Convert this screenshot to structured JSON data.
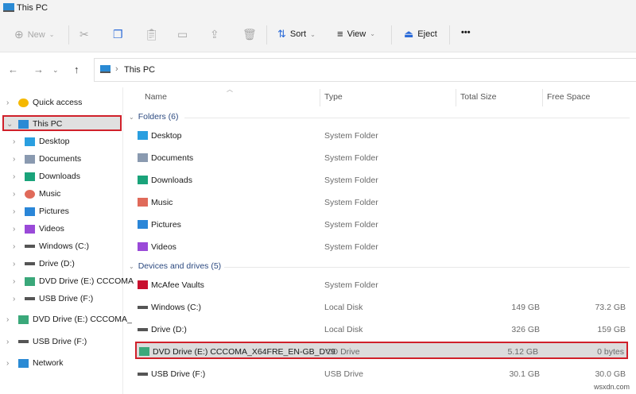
{
  "window": {
    "title": "This PC"
  },
  "toolbar": {
    "new": "New",
    "sort": "Sort",
    "view": "View",
    "eject": "Eject",
    "more": "•••"
  },
  "address": {
    "path": "This PC"
  },
  "sidebar": {
    "items": [
      {
        "label": "Quick access",
        "icon": "star-icon",
        "color": "#f5b800"
      },
      {
        "label": "This PC",
        "icon": "computer-icon",
        "color": "#2a8ad4"
      },
      {
        "label": "Desktop",
        "icon": "desktop-icon",
        "color": "#2a9fe0"
      },
      {
        "label": "Documents",
        "icon": "documents-icon",
        "color": "#8a9ab0"
      },
      {
        "label": "Downloads",
        "icon": "downloads-icon",
        "color": "#1aa37a"
      },
      {
        "label": "Music",
        "icon": "music-icon",
        "color": "#e06a5a"
      },
      {
        "label": "Pictures",
        "icon": "pictures-icon",
        "color": "#2a86d8"
      },
      {
        "label": "Videos",
        "icon": "videos-icon",
        "color": "#9a4ad8"
      },
      {
        "label": "Windows (C:)",
        "icon": "drive-icon",
        "color": "#555"
      },
      {
        "label": "Drive (D:)",
        "icon": "drive-icon",
        "color": "#555"
      },
      {
        "label": "DVD Drive (E:) CCCOMA",
        "icon": "dvd-icon",
        "color": "#3aa87a"
      },
      {
        "label": "USB Drive (F:)",
        "icon": "drive-icon",
        "color": "#555"
      },
      {
        "label": "DVD Drive (E:) CCCOMA_",
        "icon": "dvd-icon",
        "color": "#3aa87a"
      },
      {
        "label": "USB Drive (F:)",
        "icon": "drive-icon",
        "color": "#555"
      },
      {
        "label": "Network",
        "icon": "network-icon",
        "color": "#2a8ad4"
      }
    ]
  },
  "columns": {
    "name": "Name",
    "type": "Type",
    "total": "Total Size",
    "free": "Free Space"
  },
  "groups": {
    "folders": "Folders (6)",
    "devices": "Devices and drives (5)"
  },
  "folders": [
    {
      "name": "Desktop",
      "type": "System Folder",
      "color": "#2a9fe0"
    },
    {
      "name": "Documents",
      "type": "System Folder",
      "color": "#8a9ab0"
    },
    {
      "name": "Downloads",
      "type": "System Folder",
      "color": "#1aa37a"
    },
    {
      "name": "Music",
      "type": "System Folder",
      "color": "#e06a5a"
    },
    {
      "name": "Pictures",
      "type": "System Folder",
      "color": "#2a86d8"
    },
    {
      "name": "Videos",
      "type": "System Folder",
      "color": "#9a4ad8"
    }
  ],
  "drives": [
    {
      "name": "McAfee Vaults",
      "type": "System Folder",
      "total": "",
      "free": "",
      "color": "#c8102e"
    },
    {
      "name": "Windows (C:)",
      "type": "Local Disk",
      "total": "149 GB",
      "free": "73.2 GB",
      "color": "#555"
    },
    {
      "name": "Drive (D:)",
      "type": "Local Disk",
      "total": "326 GB",
      "free": "159 GB",
      "color": "#555"
    },
    {
      "name": "DVD Drive (E:) CCCOMA_X64FRE_EN-GB_DV9",
      "type": "CD Drive",
      "total": "5.12 GB",
      "free": "0 bytes",
      "color": "#3aa87a"
    },
    {
      "name": "USB Drive (F:)",
      "type": "USB Drive",
      "total": "30.1 GB",
      "free": "30.0 GB",
      "color": "#555"
    }
  ],
  "watermark": "wsxdn.com",
  "highlight_color": "#d0202a"
}
